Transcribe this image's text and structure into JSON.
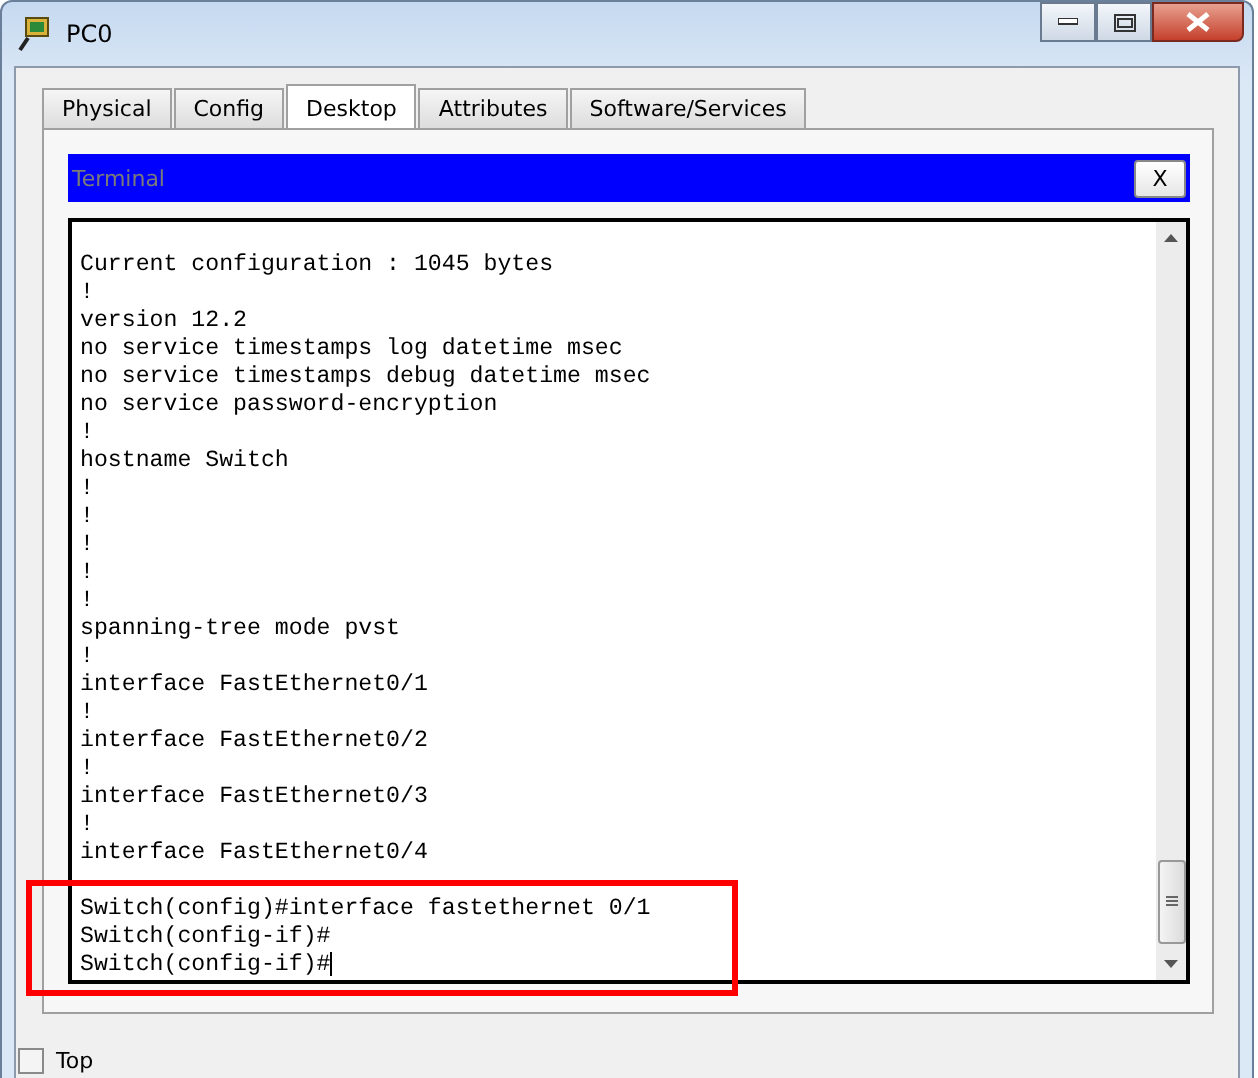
{
  "window": {
    "title": "PC0"
  },
  "tabs": [
    {
      "label": "Physical",
      "selected": false
    },
    {
      "label": "Config",
      "selected": false
    },
    {
      "label": "Desktop",
      "selected": true
    },
    {
      "label": "Attributes",
      "selected": false
    },
    {
      "label": "Software/Services",
      "selected": false
    }
  ],
  "terminal": {
    "title": "Terminal",
    "close_label": "X",
    "cursor": true,
    "output": [
      "Current configuration : 1045 bytes",
      "!",
      "version 12.2",
      "no service timestamps log datetime msec",
      "no service timestamps debug datetime msec",
      "no service password-encryption",
      "!",
      "hostname Switch",
      "!",
      "!",
      "!",
      "!",
      "!",
      "spanning-tree mode pvst",
      "!",
      "interface FastEthernet0/1",
      "!",
      "interface FastEthernet0/2",
      "!",
      "interface FastEthernet0/3",
      "!",
      "interface FastEthernet0/4"
    ],
    "prompt_lines": [
      "Switch(config)#interface fastethernet 0/1",
      "Switch(config-if)#",
      "Switch(config-if)#"
    ]
  },
  "top_checkbox": {
    "label": "Top",
    "checked": false
  }
}
